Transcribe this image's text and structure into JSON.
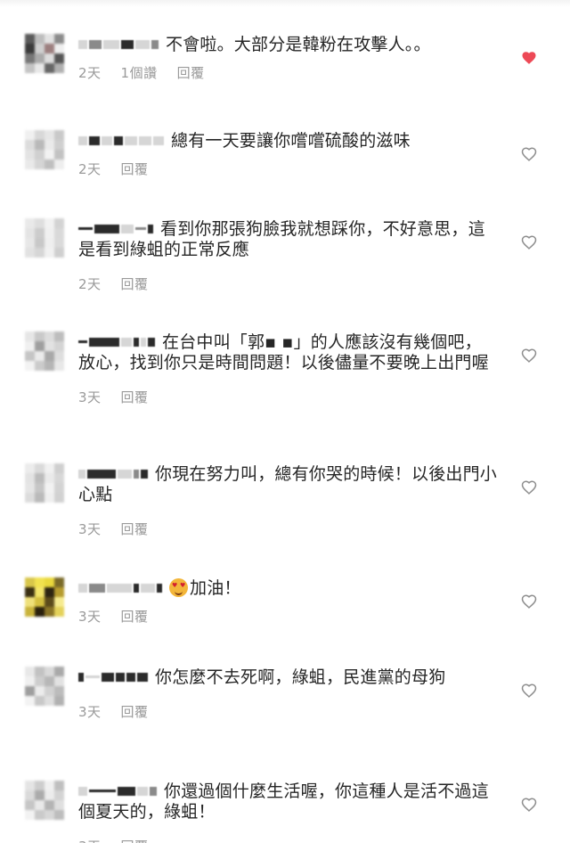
{
  "comments": [
    {
      "text": "不會啦。大部分是韓粉在攻擊人。。",
      "time": "2天",
      "likes": "1個讚",
      "reply": "回覆",
      "liked": true,
      "emoji": false
    },
    {
      "text": "總有一天要讓你嚐嚐硫酸的滋味",
      "time": "2天",
      "likes": "",
      "reply": "回覆",
      "liked": false,
      "emoji": false
    },
    {
      "text": "看到你那張狗臉我就想踩你，不好意思，這是看到綠蛆的正常反應",
      "time": "2天",
      "likes": "",
      "reply": "回覆",
      "liked": false,
      "emoji": false
    },
    {
      "text": "在台中叫「郭▪ ▪」的人應該沒有幾個吧，放心，找到你只是時間問題！以後儘量不要晚上出門喔",
      "time": "3天",
      "likes": "",
      "reply": "回覆",
      "liked": false,
      "emoji": false
    },
    {
      "text": "你現在努力叫，總有你哭的時候！以後出門小心點",
      "time": "3天",
      "likes": "",
      "reply": "回覆",
      "liked": false,
      "emoji": false
    },
    {
      "text": "加油！",
      "time": "3天",
      "likes": "",
      "reply": "回覆",
      "liked": false,
      "emoji": true
    },
    {
      "text": "你怎麼不去死啊，綠蛆，民進黨的母狗",
      "time": "3天",
      "likes": "",
      "reply": "回覆",
      "liked": false,
      "emoji": false
    },
    {
      "text": "你還過個什麼生活喔，你這種人是活不過這個夏天的，綠蛆！",
      "time": "3天",
      "likes": "",
      "reply": "回覆",
      "liked": false,
      "emoji": false
    }
  ],
  "colors": {
    "heart_filled": "#ed4956",
    "heart_outline": "#8e8e8e",
    "meta_text": "#9a9a9a",
    "comment_text": "#262626"
  },
  "icons": {
    "heart": "heart-icon",
    "avatar": "blurred-avatar"
  }
}
